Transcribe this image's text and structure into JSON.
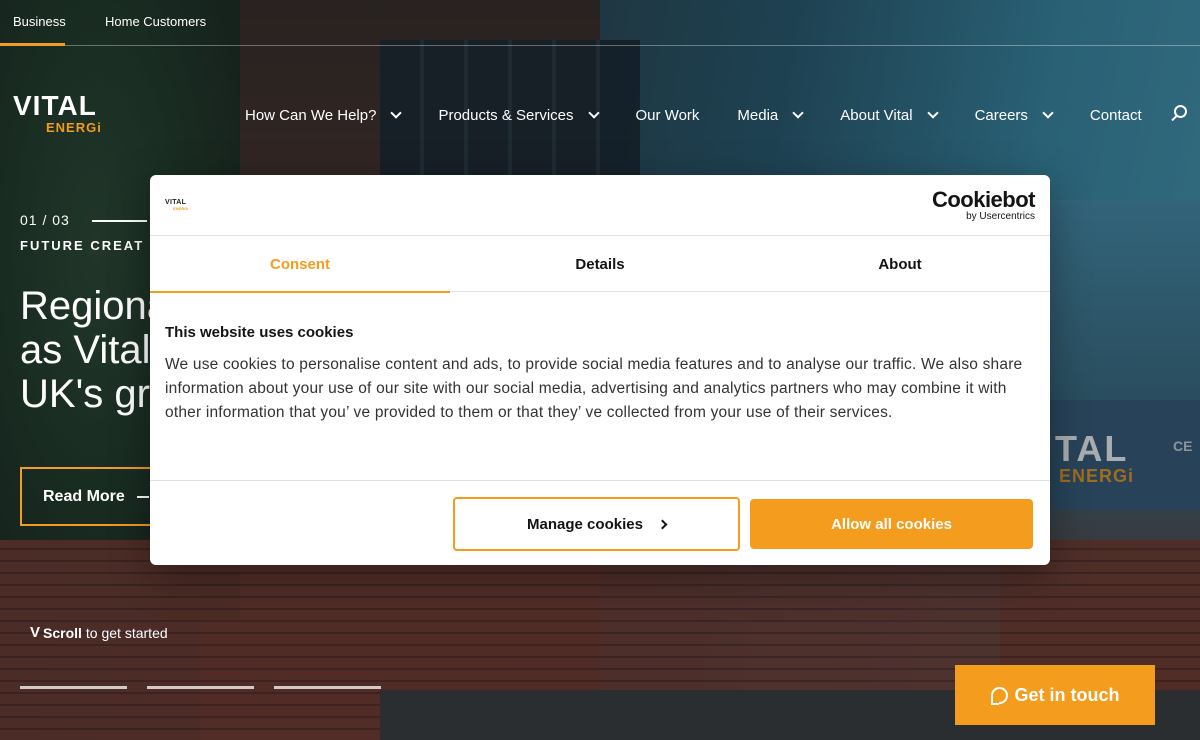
{
  "topbar": {
    "business": "Business",
    "home_customers": "Home Customers"
  },
  "logo": {
    "top": "VITAL",
    "bottom": "ENERGi"
  },
  "nav": {
    "items": [
      {
        "label": "How Can We Help?",
        "has_dropdown": true
      },
      {
        "label": "Products & Services",
        "has_dropdown": true
      },
      {
        "label": "Our Work",
        "has_dropdown": false
      },
      {
        "label": "Media",
        "has_dropdown": true
      },
      {
        "label": "About Vital",
        "has_dropdown": true
      },
      {
        "label": "Careers",
        "has_dropdown": true
      },
      {
        "label": "Contact",
        "has_dropdown": false
      }
    ],
    "search_icon": "search-icon"
  },
  "hero": {
    "slide_counter": "01 / 03",
    "kicker": "FUTURE CREAT",
    "title_lines": [
      "Regiona",
      "as Vital",
      "UK's gr"
    ],
    "read_more": "Read More",
    "scroll_bold": "Scroll",
    "scroll_rest": "to get started"
  },
  "background_sign": {
    "vital": "TAL",
    "energi": "ENERGi",
    "ce": "CE"
  },
  "get_in_touch": "Get in touch",
  "cookie": {
    "mini_logo_top": "VITAL",
    "mini_logo_bottom": "ENERGi",
    "brand": "Cookiebot",
    "brand_by": "by Usercentrics",
    "tabs": [
      "Consent",
      "Details",
      "About"
    ],
    "active_tab": "Consent",
    "heading": "This website uses cookies",
    "body": "We use cookies to personalise content and ads, to provide social media features and to analyse our traffic. We also share information about your use of our site with our social media, advertising and analytics partners who may combine it with other information that you’ ve provided to them or that they’ ve collected from your use of their services.",
    "manage_button": "Manage cookies",
    "allow_button": "Allow all cookies"
  },
  "colors": {
    "accent": "#f39c1e",
    "text_dark": "#141414"
  }
}
